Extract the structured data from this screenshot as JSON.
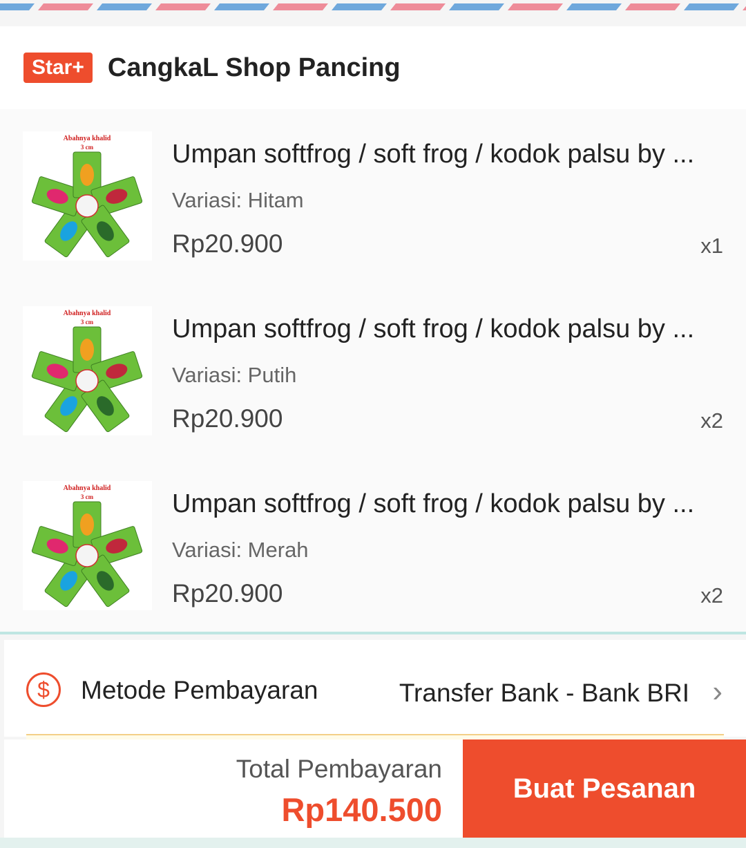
{
  "shop": {
    "badge": "Star+",
    "name": "CangkaL Shop Pancing"
  },
  "items": [
    {
      "title": "Umpan softfrog / soft frog / kodok palsu by ...",
      "variant": "Variasi: Hitam",
      "price": "Rp20.900",
      "qty": "x1",
      "image_label_1": "Abahnya khalid",
      "image_label_2": "3 cm"
    },
    {
      "title": "Umpan softfrog / soft frog / kodok palsu by ...",
      "variant": "Variasi: Putih",
      "price": "Rp20.900",
      "qty": "x2",
      "image_label_1": "Abahnya khalid",
      "image_label_2": "3 cm"
    },
    {
      "title": "Umpan softfrog / soft frog / kodok palsu by ...",
      "variant": "Variasi: Merah",
      "price": "Rp20.900",
      "qty": "x2",
      "image_label_1": "Abahnya khalid",
      "image_label_2": "3 cm"
    }
  ],
  "payment": {
    "icon": "dollar-circle-icon",
    "label": "Metode Pembayaran",
    "value": "Transfer Bank - Bank BRI",
    "chevron": "chevron-right-icon"
  },
  "footer": {
    "total_label": "Total Pembayaran",
    "total_amount": "Rp140.500",
    "order_button": "Buat Pesanan"
  },
  "colors": {
    "accent": "#ee4d2d",
    "airmail_blue": "#6fa8dc",
    "airmail_pink": "#ee8c99"
  }
}
